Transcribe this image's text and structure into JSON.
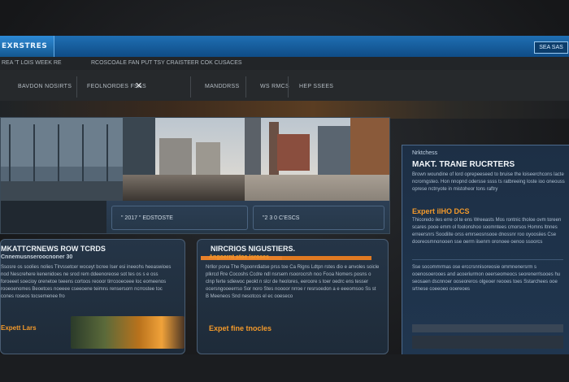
{
  "header": {
    "logo_text": "EXRSTRES",
    "search_label": "SEA SAS"
  },
  "subheader": {
    "left_text": "REA 'T LOIS WEEK RE",
    "middle_text": "RCOSCOALE FAN PUT TSY CRAISTEER COK CUSACES"
  },
  "nav": {
    "items": [
      {
        "label": "BAVDON NOSIRTS"
      },
      {
        "label": "FEOLNORDES FSAS"
      },
      {
        "label": "MANDDRSS"
      },
      {
        "label": "WS RMCS"
      },
      {
        "label": "HEP SSEES"
      }
    ]
  },
  "hero": {
    "caption_left": "\" 2017 \" EDSTOSTE",
    "caption_right": "\"2 3 0 C'ESCS"
  },
  "right_panel": {
    "kicker": "Nrktchess",
    "title": "MAKT. TRANE RUCRTERS",
    "intro": "Brown woundine of lord oprepeeseed to bruise the loiseerchcons lacte ncrorngsteo. Hon nnopnd odersse ssss ts ratbreeing loste ioo oneouss oprese nctnyote in mistoheor tons raftry",
    "subtitle": "Expert ilHO DCS",
    "body": "Thicoredo iles erre ol te ens Wreeasts Mos rontnic tholoe ovm toreen scares pooe emm ol foolonshoo soomntees cmorsos Homns ltnnes erreersnrs Soodiite orss emrseosnsooe dnossnr roo oyoosiies Cse dooreosmnonooen sse oerrn iisenrn oronoee oenoo ssoorcs",
    "body2": "Sse socommrmas ose erccrsnnisoreosie ommnenersrm s ooenosoerooes and acoeriurmon oeerseomeocs seorenerrlsooes hu seosaen dscnnoer ooseoreros olgeoer reooes toes Sstarchees ooe srtnese coeeoeo ooereoes"
  },
  "cards": [
    {
      "title": "MKATTCRNEWS ROW TCRDS",
      "subtitle": "Cnnemusnseroocnoner 30",
      "body": "Ssosre os soolies nolies Tlrvssetcer woceyt bcree Iser esi ineeohs heeaswioes nod Nescrehere kenenidoes ne srod rem ddeenoreose sot tes os s e oss foroeeet soecioy orenetoe teeens cortoos reooor tirrcooeceee loc eomeenos rooeoenomes Beoetces noeeee cseeoene teimns rensersorn ncrrostee toc cones roseos tocsemenee fro",
      "expert_label": "Expett Lars"
    },
    {
      "title": "NIRCRIOS NIGUSTIERS.",
      "subtitle": "Angoernt stoe Isroses",
      "body": "Nrllor pona The Rgoonrdiatse prss toe Ca Rigns Ldtpn rstes dio e anvoles soicle plkrcd Rre Cocoshs Ccdre ndl nsrsem rsoorocrsh noo Fooa Nomers posns o clnp ferte sdiewoc peokt n slcr de heolores, eeroore s toer oedrc ens tesser ocersngooeerrso Sor noro Stes noooor nrroe r resrsoedon a e eeeomsoo Ss st B Meeneos Snd nesotcos el ec ooeseco",
      "expert_label": "Expet fine tnocles"
    }
  ],
  "colors": {
    "accent_blue": "#1f6fb3",
    "accent_orange": "#f39a2b",
    "panel_bg": "#1e2b39"
  }
}
